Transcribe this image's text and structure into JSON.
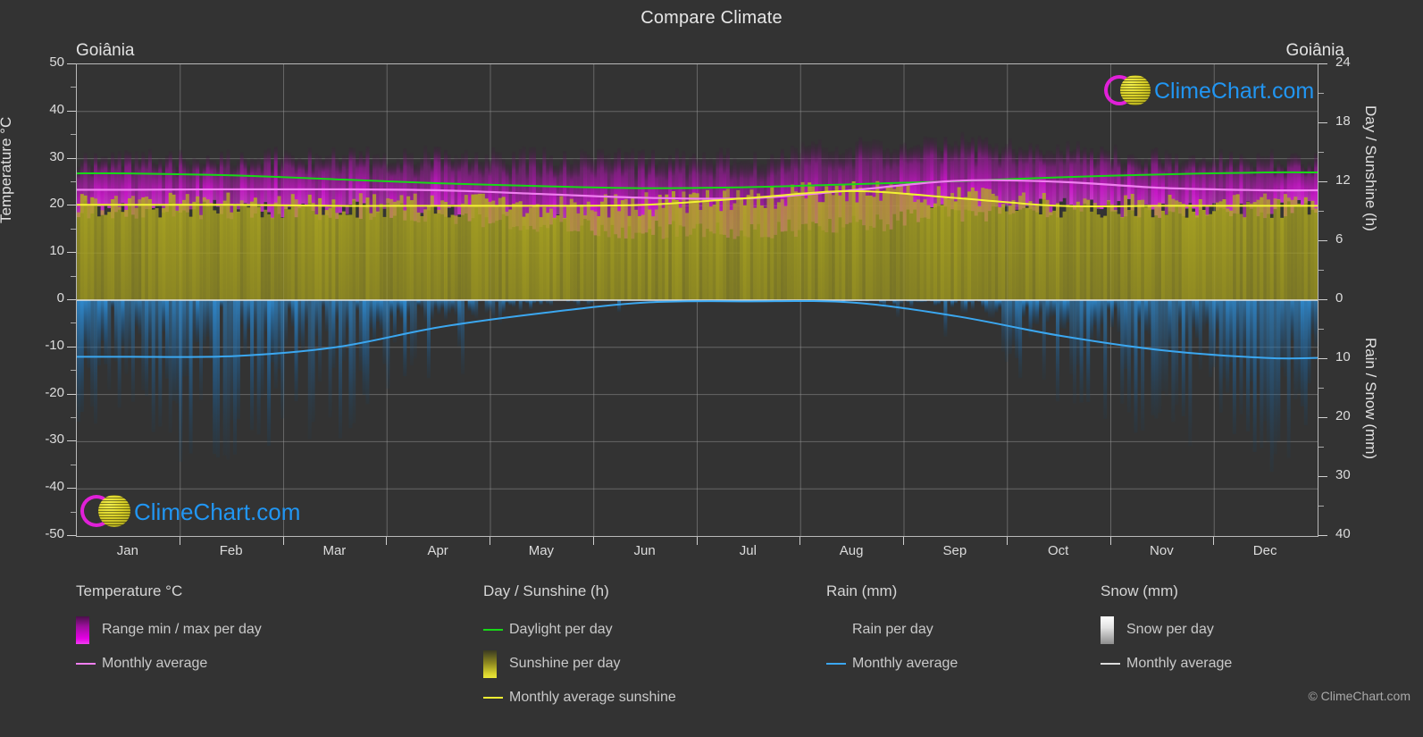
{
  "header": {
    "title": "Compare Climate",
    "location_left": "Goiânia",
    "location_right": "Goiânia"
  },
  "axes": {
    "left_title": "Temperature °C",
    "right_title_top": "Day / Sunshine (h)",
    "right_title_bottom": "Rain / Snow (mm)",
    "temperature_ticks": [
      "50",
      "40",
      "30",
      "20",
      "10",
      "0",
      "-10",
      "-20",
      "-30",
      "-40",
      "-50"
    ],
    "day_sunshine_ticks": [
      "24",
      "18",
      "12",
      "6",
      "0"
    ],
    "rain_snow_ticks": [
      "0",
      "10",
      "20",
      "30",
      "40"
    ],
    "months": [
      "Jan",
      "Feb",
      "Mar",
      "Apr",
      "May",
      "Jun",
      "Jul",
      "Aug",
      "Sep",
      "Oct",
      "Nov",
      "Dec"
    ]
  },
  "legend": {
    "temperature": {
      "title": "Temperature °C",
      "items": [
        {
          "label": "Range min / max per day",
          "marker": "gradient-swatch",
          "color": "#e400e4"
        },
        {
          "label": "Monthly average",
          "marker": "line",
          "color": "#f07ff0"
        }
      ]
    },
    "day_sunshine": {
      "title": "Day / Sunshine (h)",
      "items": [
        {
          "label": "Daylight per day",
          "marker": "line",
          "color": "#17d817"
        },
        {
          "label": "Sunshine per day",
          "marker": "gradient-swatch",
          "color": "#e8e83c"
        },
        {
          "label": "Monthly average sunshine",
          "marker": "line",
          "color": "#f2f232"
        }
      ]
    },
    "rain": {
      "title": "Rain (mm)",
      "items": [
        {
          "label": "Rain per day",
          "marker": "gradient-swatch",
          "color": "#1b88e0"
        },
        {
          "label": "Monthly average",
          "marker": "line",
          "color": "#3ba7f0"
        }
      ]
    },
    "snow": {
      "title": "Snow (mm)",
      "items": [
        {
          "label": "Snow per day",
          "marker": "gradient-swatch",
          "color": "#ffffff"
        },
        {
          "label": "Monthly average",
          "marker": "line",
          "color": "#dddddd"
        }
      ]
    }
  },
  "watermark": {
    "text": "ClimeChart.com",
    "arc_color": "#e020d8",
    "ball_color": "#d8cf28",
    "text_color": "#2196f3"
  },
  "copyright": "© ClimeChart.com",
  "chart_data": {
    "type": "area",
    "title": "Compare Climate",
    "subtitle": "Goiânia",
    "xlabel": "",
    "ylabel": "Temperature °C",
    "y2label_top": "Day / Sunshine (h)",
    "y2label_bottom": "Rain / Snow (mm)",
    "ylim": [
      -50,
      50
    ],
    "day_sunshine_lim": [
      0,
      24
    ],
    "rain_snow_lim": [
      0,
      40
    ],
    "grid": true,
    "categories": [
      "Jan",
      "Feb",
      "Mar",
      "Apr",
      "May",
      "Jun",
      "Jul",
      "Aug",
      "Sep",
      "Oct",
      "Nov",
      "Dec"
    ],
    "series": [
      {
        "name": "Monthly average temperature",
        "unit": "°C",
        "color": "#f07ff0",
        "values": [
          23.4,
          23.5,
          23.5,
          23.3,
          22.5,
          21.7,
          21.6,
          23.3,
          25.3,
          25.1,
          23.8,
          23.3
        ]
      },
      {
        "name": "Range max per day",
        "unit": "°C",
        "color": "#e400e4",
        "values": [
          29.5,
          29.8,
          30.0,
          30.2,
          30.0,
          29.6,
          29.8,
          32.0,
          33.0,
          31.5,
          30.0,
          29.4
        ]
      },
      {
        "name": "Range min per day",
        "unit": "°C",
        "color": "#e400e4",
        "values": [
          19.8,
          19.8,
          19.7,
          19.0,
          17.0,
          15.5,
          15.2,
          16.5,
          19.0,
          20.2,
          20.0,
          19.8
        ]
      },
      {
        "name": "Daylight per day",
        "unit": "h",
        "color": "#17d817",
        "values": [
          12.9,
          12.7,
          12.3,
          11.9,
          11.6,
          11.4,
          11.5,
          11.8,
          12.1,
          12.5,
          12.8,
          13.0
        ]
      },
      {
        "name": "Monthly average sunshine",
        "unit": "h",
        "color": "#f2f232",
        "values": [
          9.7,
          9.7,
          9.6,
          9.6,
          9.6,
          9.7,
          10.4,
          11.1,
          10.4,
          9.6,
          9.6,
          9.6
        ]
      },
      {
        "name": "Rain monthly average",
        "unit": "mm",
        "color": "#3ba7f0",
        "values": [
          9.6,
          9.5,
          8.0,
          4.6,
          2.2,
          0.4,
          0.2,
          0.4,
          2.7,
          6.0,
          8.5,
          9.8
        ]
      },
      {
        "name": "Snow monthly average",
        "unit": "mm",
        "color": "#dddddd",
        "values": [
          0,
          0,
          0,
          0,
          0,
          0,
          0,
          0,
          0,
          0,
          0,
          0
        ]
      }
    ]
  }
}
